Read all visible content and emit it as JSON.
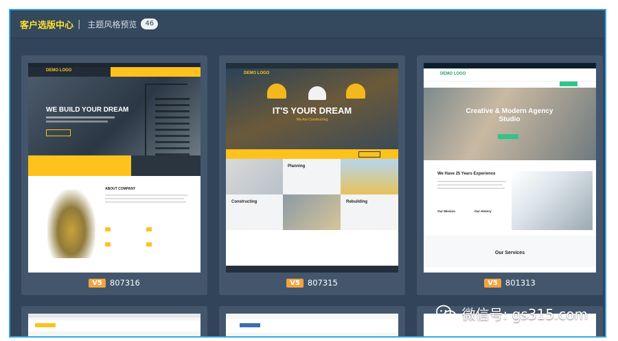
{
  "header": {
    "brand": "客户选版中心",
    "separator": "|",
    "subtitle": "主题风格预览",
    "count": "46"
  },
  "cards": [
    {
      "tag": "V5",
      "code": "807316",
      "logo": "DEMO LOGO",
      "hero": "WE BUILD YOUR DREAM",
      "section": "ABOUT COMPANY"
    },
    {
      "tag": "V5",
      "code": "807315",
      "logo": "DEMO LOGO",
      "hero": "IT'S YOUR DREAM",
      "hero_sub": "We Are Constructing",
      "tiles": [
        "Planning",
        "Constructing",
        "Rebuilding"
      ]
    },
    {
      "tag": "V5",
      "code": "801313",
      "logo": "DEMO LOGO",
      "hero": "Creative & Modern Agency Studio",
      "about": "We Have 25 Years Experience",
      "services": "Our Services",
      "features": [
        "Our Mission",
        "Our History"
      ]
    }
  ],
  "watermark": {
    "text": "微信号: gs315.com"
  },
  "colors": {
    "accent": "#ffe22d",
    "frame_border": "#38a6e0",
    "tag": "#f4a340",
    "background": "#324459"
  }
}
